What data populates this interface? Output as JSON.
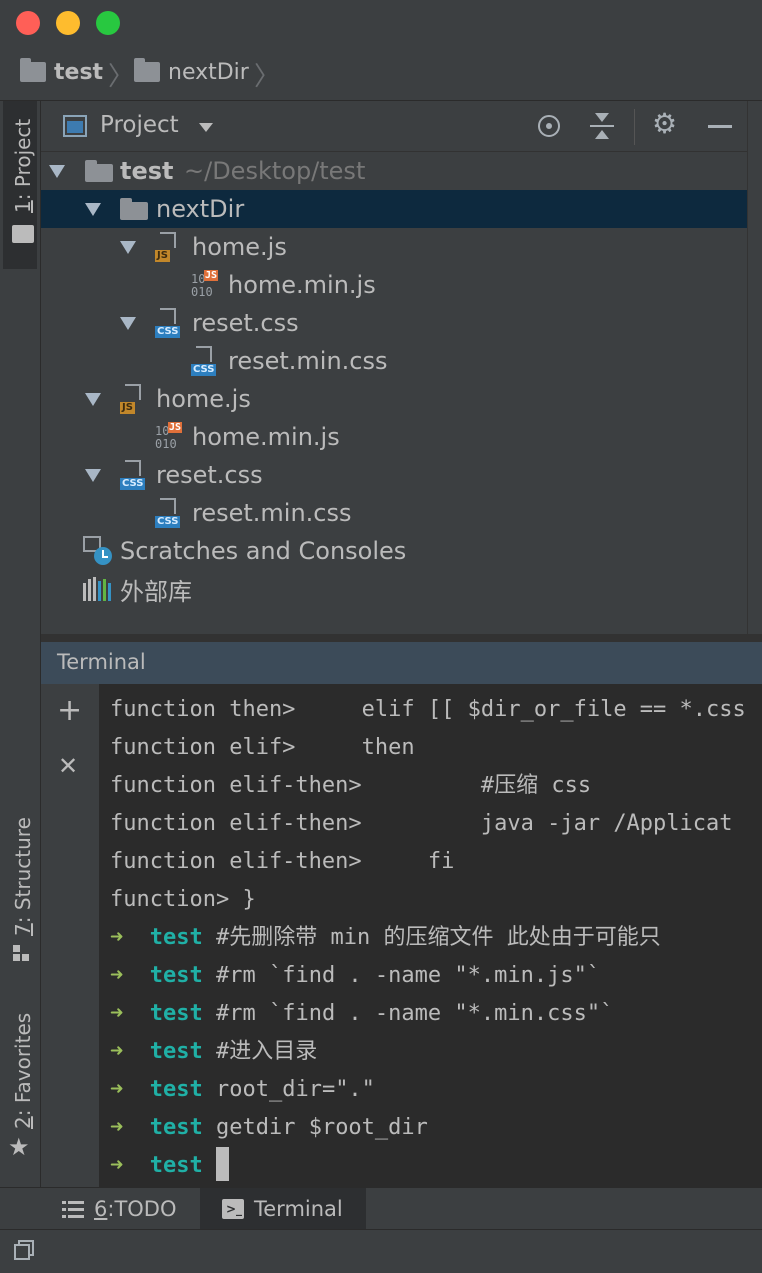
{
  "window": {
    "buttons": [
      "close",
      "minimize",
      "maximize"
    ]
  },
  "breadcrumb": [
    {
      "label": "test",
      "icon": "folder-icon"
    },
    {
      "label": "nextDir",
      "icon": "folder-icon"
    }
  ],
  "left_strip": {
    "project_tab": {
      "number": "1",
      "label": "Project"
    },
    "structure_tab": {
      "number": "7",
      "label": "Structure"
    },
    "favorites_tab": {
      "number": "2",
      "label": "Favorites"
    }
  },
  "project_panel": {
    "title": "Project",
    "tools": [
      "locate-icon",
      "collapse-all-icon",
      "gear-icon",
      "hide-icon"
    ],
    "tree": [
      {
        "label": "test",
        "path": "~/Desktop/test",
        "kind": "folder",
        "level": 0,
        "expanded": true
      },
      {
        "label": "nextDir",
        "kind": "folder",
        "level": 1,
        "expanded": true,
        "selected": true
      },
      {
        "label": "home.js",
        "kind": "js",
        "level": 2,
        "expanded": true
      },
      {
        "label": "home.min.js",
        "kind": "min-js",
        "level": 3
      },
      {
        "label": "reset.css",
        "kind": "css",
        "level": 2,
        "expanded": true
      },
      {
        "label": "reset.min.css",
        "kind": "css",
        "level": 3
      },
      {
        "label": "home.js",
        "kind": "js",
        "level": 1,
        "expanded": true
      },
      {
        "label": "home.min.js",
        "kind": "min-js",
        "level": 2
      },
      {
        "label": "reset.css",
        "kind": "css",
        "level": 1,
        "expanded": true
      },
      {
        "label": "reset.min.css",
        "kind": "css",
        "level": 2
      },
      {
        "label": "Scratches and Consoles",
        "kind": "scratches",
        "level": 0
      },
      {
        "label": "外部库",
        "kind": "library",
        "level": 0
      }
    ]
  },
  "terminal": {
    "title": "Terminal",
    "lines": [
      {
        "type": "plain",
        "text": "function then>     elif [[ $dir_or_file == *.css"
      },
      {
        "type": "plain",
        "text": "function elif>     then"
      },
      {
        "type": "plain",
        "text": "function elif-then>         #压缩 css"
      },
      {
        "type": "plain",
        "text": "function elif-then>         java -jar /Applicat"
      },
      {
        "type": "plain",
        "text": "function elif-then>     fi"
      },
      {
        "type": "plain",
        "text": "function> }"
      },
      {
        "type": "prompt",
        "arrow": "➜",
        "dir": "test",
        "cmd": "#先删除带 min 的压缩文件 此处由于可能只"
      },
      {
        "type": "prompt",
        "arrow": "➜",
        "dir": "test",
        "cmd": "#rm `find . -name \"*.min.js\"`"
      },
      {
        "type": "prompt",
        "arrow": "➜",
        "dir": "test",
        "cmd": "#rm `find . -name \"*.min.css\"`"
      },
      {
        "type": "prompt",
        "arrow": "➜",
        "dir": "test",
        "cmd": "#进入目录"
      },
      {
        "type": "prompt",
        "arrow": "➜",
        "dir": "test",
        "cmd": "root_dir=\".\""
      },
      {
        "type": "prompt",
        "arrow": "➜",
        "dir": "test",
        "cmd": "getdir $root_dir"
      },
      {
        "type": "prompt",
        "arrow": "➜",
        "dir": "test",
        "cmd": "",
        "cursor": true
      }
    ],
    "side_buttons": {
      "add": "+",
      "close": "✕"
    }
  },
  "bottom_tabs": [
    {
      "number": "6",
      "label": "TODO",
      "icon": "list-icon",
      "active": false
    },
    {
      "number": "",
      "label": "Terminal",
      "icon": "terminal-icon",
      "active": true
    }
  ],
  "colors": {
    "selection": "#0d293e",
    "terminal_header": "#3c4b59",
    "prompt_arrow": "#9bbf5b",
    "prompt_dir": "#20b0a6"
  }
}
